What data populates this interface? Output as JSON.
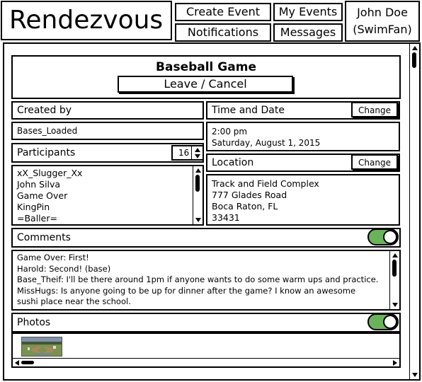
{
  "header": {
    "app_title": "Rendezvous",
    "create_event": "Create Event",
    "my_events": "My Events",
    "notifications": "Notifications",
    "messages": "Messages",
    "user_name": "John Doe",
    "user_handle": "(SwimFan)"
  },
  "event": {
    "title": "Baseball Game",
    "leave_button": "Leave / Cancel",
    "created_by_label": "Created by",
    "created_by_value": "Bases_Loaded",
    "time_label": "Time and Date",
    "time_change": "Change",
    "time_value": "2:00 pm",
    "date_value": "Saturday, August 1, 2015",
    "participants_label": "Participants",
    "participants_count": "16",
    "participants": [
      "xX_Slugger_Xx",
      "John Silva",
      "Game Over",
      "KingPin",
      "=Baller="
    ],
    "location_label": "Location",
    "location_change": "Change",
    "location_lines": [
      "Track and Field Complex",
      "777 Glades Road",
      "Boca Raton, FL",
      "33431"
    ],
    "comments_label": "Comments",
    "comments": [
      "Game Over: First!",
      "Harold: Second! (base)",
      "Base_Theif: I'll be there around 1pm if anyone wants to do some warm ups and practice.",
      "MissHugs: Is anyone going to be up for dinner after the game?  I know an awesome",
      "sushi place near the school."
    ],
    "photos_label": "Photos"
  },
  "colors": {
    "toggle_on": "#6bb35a",
    "border": "#000000"
  }
}
